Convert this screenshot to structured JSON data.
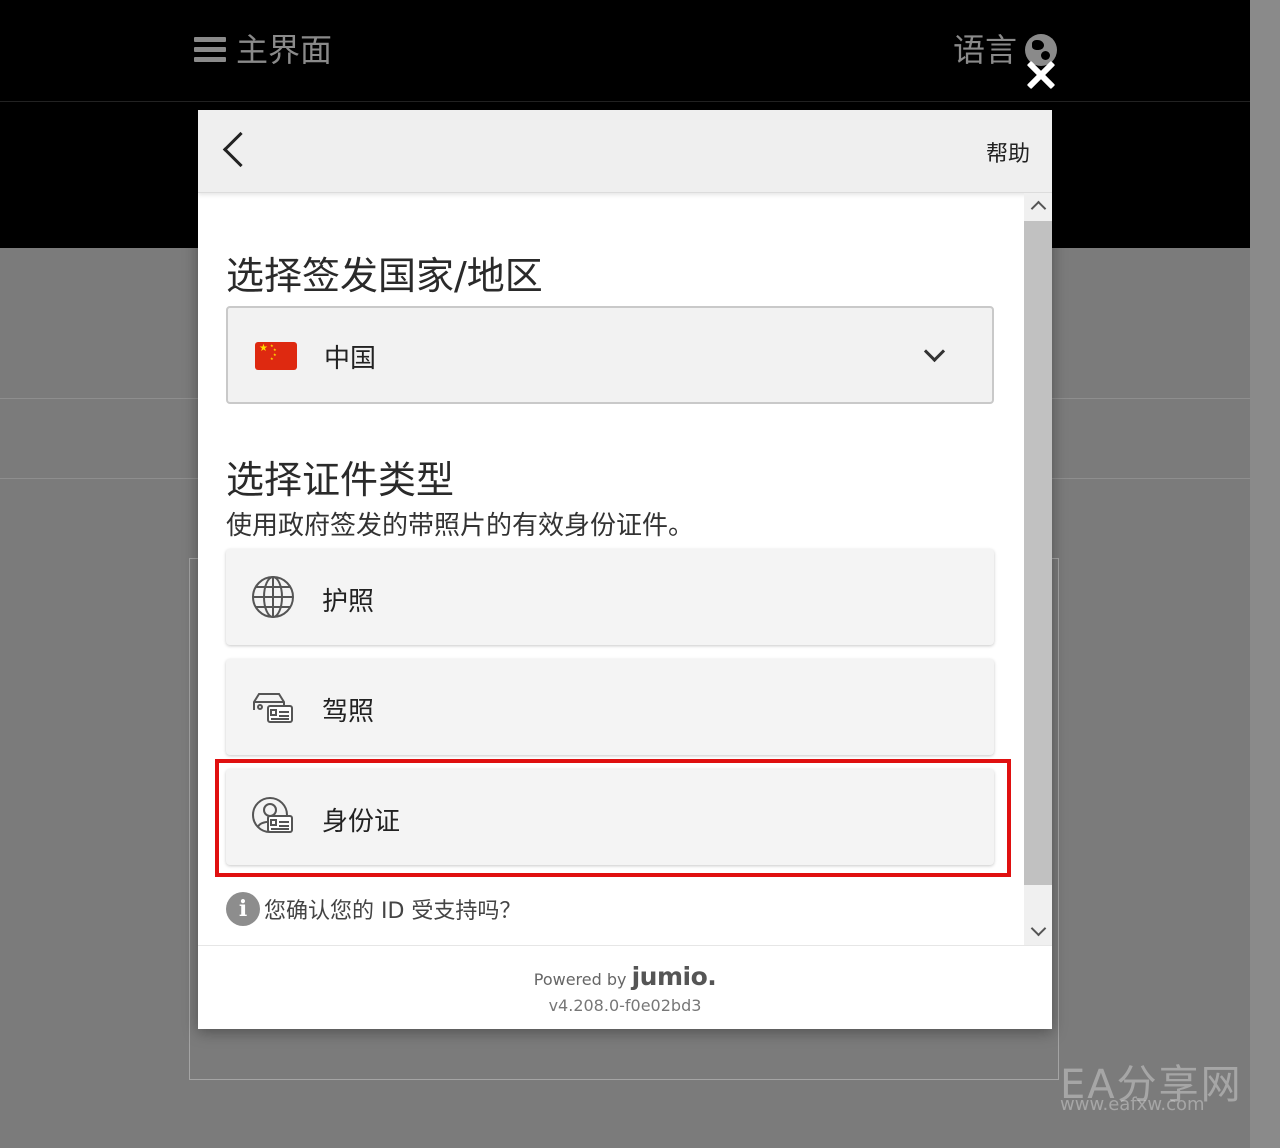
{
  "background": {
    "menu_label": "主界面",
    "language_label": "语言"
  },
  "modal": {
    "help_label": "帮助",
    "country_section_title": "选择签发国家/地区",
    "selected_country": "中国",
    "doc_section_title": "选择证件类型",
    "doc_section_subtitle": "使用政府签发的带照片的有效身份证件。",
    "documents": [
      {
        "label": "护照",
        "icon": "globe-icon"
      },
      {
        "label": "驾照",
        "icon": "driver-license-icon"
      },
      {
        "label": "身份证",
        "icon": "id-card-icon"
      }
    ],
    "info_text": "您确认您的 ID 受支持吗？",
    "footer": {
      "powered_by": "Powered by",
      "brand": "jumio.",
      "version": "v4.208.0-f0e02bd3"
    }
  },
  "watermark": {
    "text": "EA分享网",
    "sub": "www.eafxw.com"
  },
  "colors": {
    "highlight": "#e01010",
    "flag_red": "#de2910",
    "flag_star": "#ffde00"
  }
}
